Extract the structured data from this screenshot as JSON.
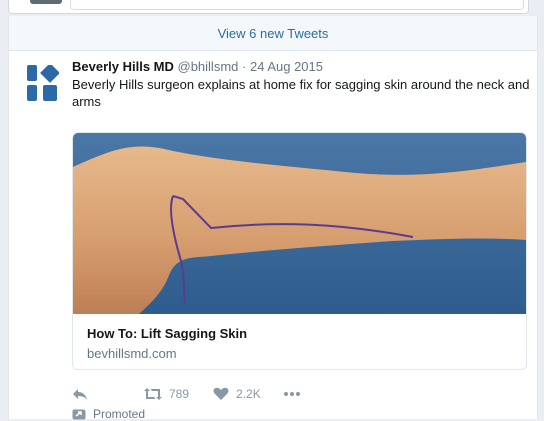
{
  "stream": {
    "new_tweets_label": "View 6 new Tweets"
  },
  "tweet": {
    "author_name": "Beverly Hills MD",
    "author_handle": "@bhillsmd",
    "separator": "·",
    "date": "24 Aug 2015",
    "text": "Beverly Hills surgeon explains at home fix for sagging skin around the neck and arms",
    "card": {
      "title": "How To: Lift Sagging Skin",
      "domain": "bevhillsmd.com"
    },
    "actions": {
      "reply_icon": "reply-icon",
      "retweet_icon": "retweet-icon",
      "retweet_count": "789",
      "like_icon": "heart-icon",
      "like_count": "2.2K",
      "more_icon": "more-icon"
    },
    "promoted_label": "Promoted"
  },
  "colors": {
    "brand_blue": "#2b6aa7",
    "link": "#2a6f97",
    "secondary_text": "#657786",
    "background": "#eaeef2"
  }
}
